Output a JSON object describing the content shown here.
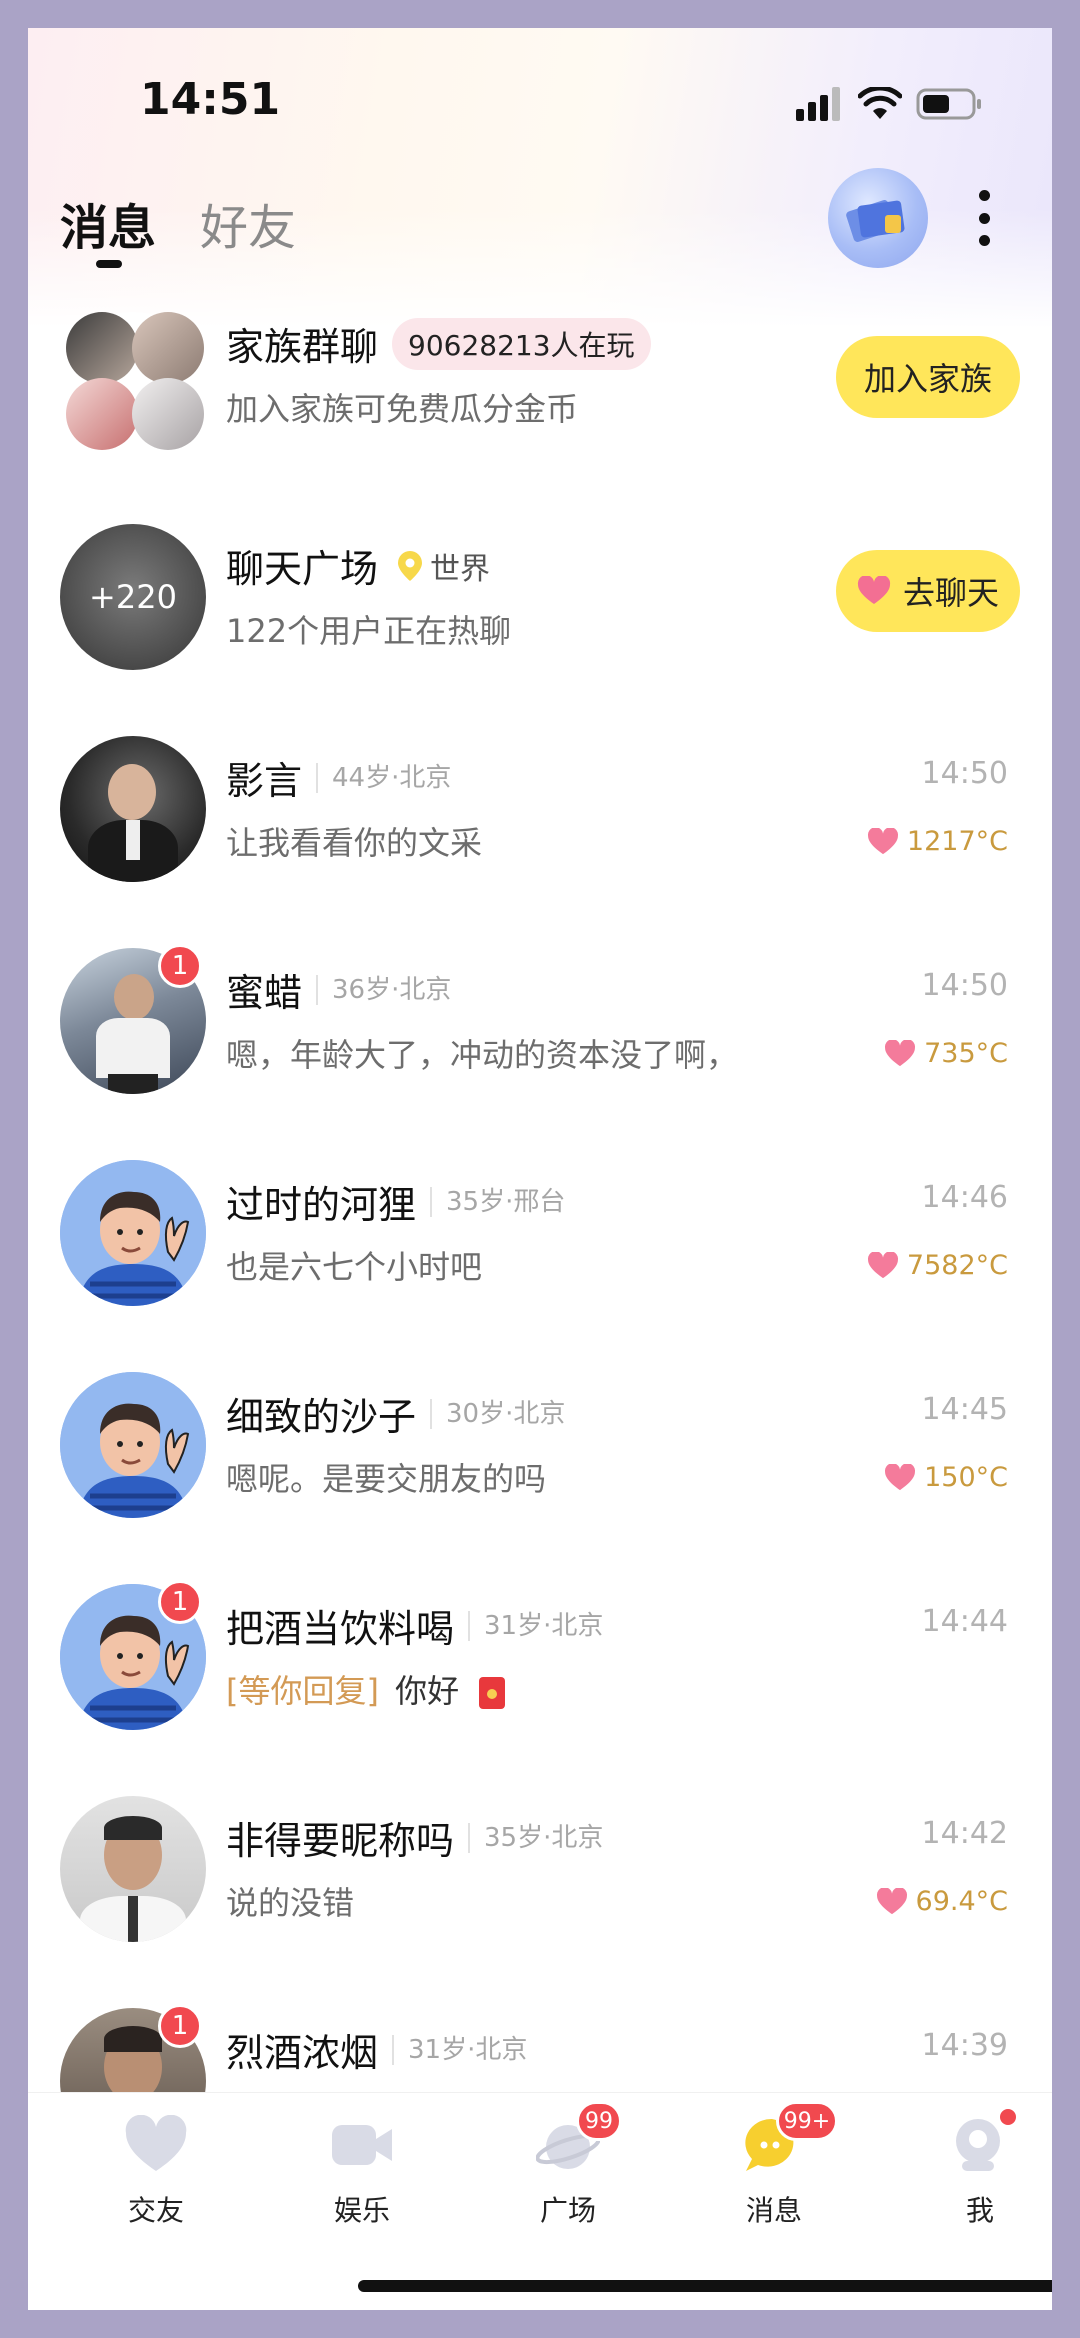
{
  "status_bar": {
    "time": "14:51"
  },
  "header": {
    "tabs": [
      {
        "label": "消息"
      },
      {
        "label": "好友"
      }
    ]
  },
  "family": {
    "title": "家族群聊",
    "online": "90628213人在玩",
    "subtitle": "加入家族可免费瓜分金币",
    "button": "加入家族"
  },
  "plaza": {
    "avatar_count": "+220",
    "title": "聊天广场",
    "scope": "世界",
    "subtitle": "122个用户正在热聊",
    "button": "去聊天"
  },
  "chats": [
    {
      "name": "影言",
      "meta": "44岁·北京",
      "message": "让我看看你的文采",
      "time": "14:50",
      "temp": "1217°C",
      "unread": ""
    },
    {
      "name": "蜜蜡",
      "meta": "36岁·北京",
      "message": "嗯，年龄大了，冲动的资本没了啊，",
      "time": "14:50",
      "temp": "735°C",
      "unread": "1"
    },
    {
      "name": "过时的河狸",
      "meta": "35岁·邢台",
      "message": "也是六七个小时吧",
      "time": "14:46",
      "temp": "7582°C",
      "unread": ""
    },
    {
      "name": "细致的沙子",
      "meta": "30岁·北京",
      "message": "嗯呢。是要交朋友的吗",
      "time": "14:45",
      "temp": "150°C",
      "unread": ""
    },
    {
      "name": "把酒当饮料喝",
      "meta": "31岁·北京",
      "reply_tag": "[等你回复]",
      "message": "你好",
      "time": "14:44",
      "unread": "1"
    },
    {
      "name": "非得要昵称吗",
      "meta": "35岁·北京",
      "message": "说的没错",
      "time": "14:42",
      "temp": "69.4°C",
      "unread": ""
    },
    {
      "name": "烈酒浓烟",
      "meta": "31岁·北京",
      "time": "14:39",
      "unread": "1"
    }
  ],
  "nav": [
    {
      "label": "交友",
      "badge": ""
    },
    {
      "label": "娱乐",
      "badge": ""
    },
    {
      "label": "广场",
      "badge": "99"
    },
    {
      "label": "消息",
      "badge": "99+"
    },
    {
      "label": "我",
      "badge": ""
    }
  ],
  "colors": {
    "accent_yellow": "#ffe65a",
    "badge_red": "#f1494f",
    "temp_gold": "#c99a3e"
  }
}
